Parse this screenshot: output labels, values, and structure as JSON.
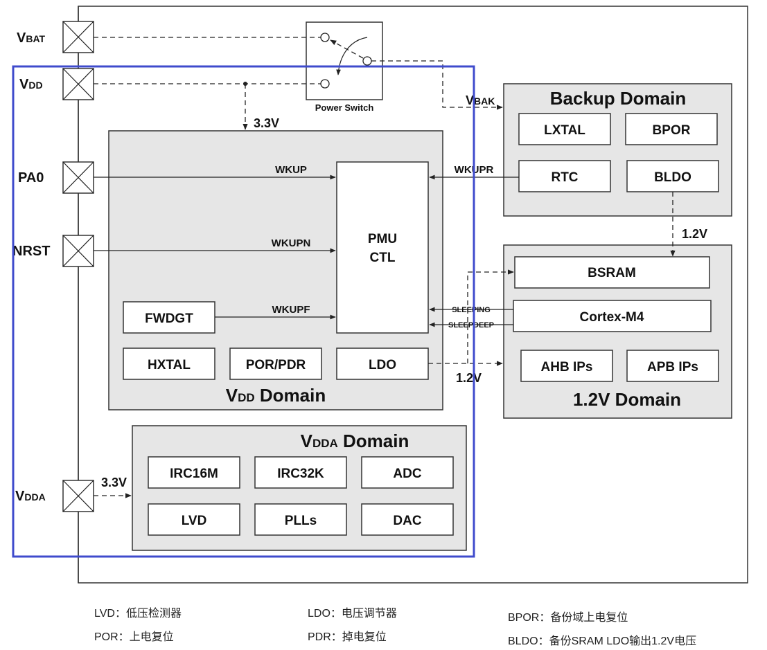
{
  "pins": {
    "vbat": {
      "main": "V",
      "sub": "BAT"
    },
    "vdd": {
      "main": "V",
      "sub": "DD"
    },
    "pa0": "PA0",
    "nrst": "NRST",
    "vdda": {
      "main": "V",
      "sub": "DDA"
    }
  },
  "power_switch": {
    "label": "Power Switch"
  },
  "vbak": {
    "main": "V",
    "sub": "BAK"
  },
  "voltages": {
    "vdd_3v3": "3.3V",
    "vdda_3v3": "3.3V",
    "bldo_1v2": "1.2V",
    "ldo_1v2": "1.2V"
  },
  "signals": {
    "wkup": "WKUP",
    "wkupn": "WKUPN",
    "wkupf": "WKUPF",
    "wkupr": "WKUPR",
    "sleeping": "SLEEPING",
    "sleepdeep": "SLEEPDEEP"
  },
  "backup_domain": {
    "title": "Backup Domain",
    "blocks": [
      "LXTAL",
      "BPOR",
      "RTC",
      "BLDO"
    ]
  },
  "domain_1v2": {
    "title": "1.2V Domain",
    "blocks": [
      "BSRAM",
      "Cortex-M4",
      "AHB IPs",
      "APB IPs"
    ]
  },
  "vdd_domain": {
    "title_main": "V",
    "title_sub": "DD",
    "title_rest": " Domain",
    "pmu": [
      "PMU",
      "CTL"
    ],
    "blocks": [
      "FWDGT",
      "HXTAL",
      "POR/PDR",
      "LDO"
    ]
  },
  "vdda_domain": {
    "title_main": "V",
    "title_sub": "DDA",
    "title_rest": " Domain",
    "blocks": [
      "IRC16M",
      "IRC32K",
      "ADC",
      "LVD",
      "PLLs",
      "DAC"
    ]
  },
  "legend": [
    {
      "key": "LVD",
      "text": "：低压检测器"
    },
    {
      "key": "POR",
      "text": "：上电复位"
    },
    {
      "key": "LDO",
      "text": "：电压调节器"
    },
    {
      "key": "PDR",
      "text": "：掉电复位"
    },
    {
      "key": "BPOR",
      "text": "：备份域上电复位"
    },
    {
      "key": "BLDO",
      "text": "：备份SRAM LDO输出1.2V电压"
    }
  ],
  "colors": {
    "highlight_frame": "#3f4bcc",
    "domain_fill": "#e6e6e6"
  }
}
